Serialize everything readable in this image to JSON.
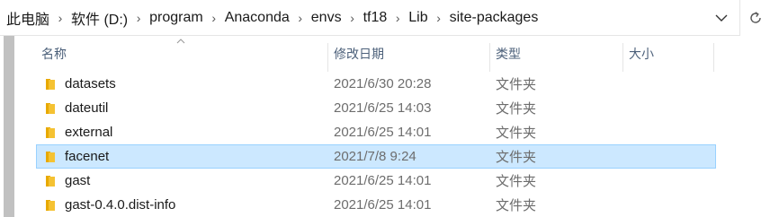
{
  "address": {
    "crumbs": [
      "此电脑",
      "软件 (D:)",
      "program",
      "Anaconda",
      "envs",
      "tf18",
      "Lib",
      "site-packages"
    ],
    "separator": "›"
  },
  "columns": {
    "name": "名称",
    "date": "修改日期",
    "type": "类型",
    "size": "大小"
  },
  "files": [
    {
      "name": "datasets",
      "date": "2021/6/30 20:28",
      "type": "文件夹",
      "selected": false
    },
    {
      "name": "dateutil",
      "date": "2021/6/25 14:03",
      "type": "文件夹",
      "selected": false
    },
    {
      "name": "external",
      "date": "2021/6/25 14:01",
      "type": "文件夹",
      "selected": false
    },
    {
      "name": "facenet",
      "date": "2021/7/8 9:24",
      "type": "文件夹",
      "selected": true
    },
    {
      "name": "gast",
      "date": "2021/6/25 14:01",
      "type": "文件夹",
      "selected": false
    },
    {
      "name": "gast-0.4.0.dist-info",
      "date": "2021/6/25 14:01",
      "type": "文件夹",
      "selected": false
    }
  ],
  "colors": {
    "selection_bg": "#cce8ff",
    "selection_border": "#99d1ff",
    "folder": "#f5c232",
    "header_text": "#4c607a"
  },
  "icons": {
    "address_dropdown": "chevron-down-icon",
    "refresh": "refresh-icon",
    "scroll_up": "scroll-up-arrow-icon",
    "sort": "sort-ascending-icon",
    "folder": "folder-icon"
  }
}
